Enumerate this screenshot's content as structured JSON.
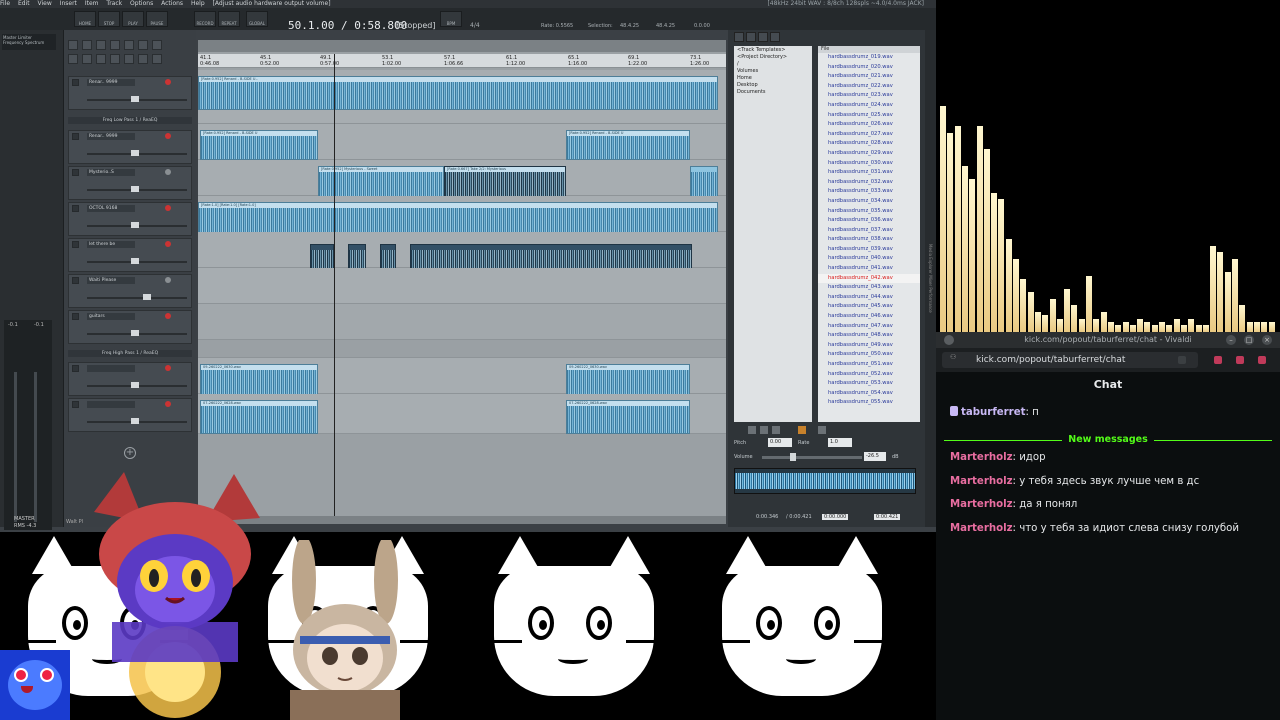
{
  "daw": {
    "menu": [
      "File",
      "Edit",
      "View",
      "Insert",
      "Item",
      "Track",
      "Options",
      "Actions",
      "Help",
      "[Adjust audio hardware output volume]"
    ],
    "status_right": "[48kHz 24bit WAV : 8/8ch 128spls ~4.0/4.0ms JACK]",
    "transport": {
      "time": "50.1.00 / 0:58.800",
      "state": "[Stopped]",
      "signature": "4/4",
      "rate": "Rate: 0.5565",
      "selection": "Selection:",
      "sel_start": "48.4.25",
      "sel_end": "48.4.25",
      "sel_len": "0.0.00",
      "buttons": [
        "HOME",
        "STOP",
        "PLAY",
        "PAUSE",
        "RECORD",
        "REPEAT",
        "GLOBAL AUTO",
        "BPM"
      ]
    },
    "master": {
      "label": "Master Limiter",
      "sub": "Frequency Spectrum",
      "rms": "RMS -4.3",
      "name": "MASTER",
      "db_left": "-0.1",
      "db_right": "-0.1"
    },
    "folders": [
      "Freq Low Pass 1 / ReaEQ",
      "Freq High Pass 1 / ReaEQ"
    ],
    "tracks": [
      {
        "name": "Renar.. 9999"
      },
      {
        "name": "Renar.. 9999"
      },
      {
        "name": "Mysterio..S"
      },
      {
        "name": "OCTOL 9168"
      },
      {
        "name": "let there be"
      },
      {
        "name": "Waiti Please"
      },
      {
        "name": "guitars"
      },
      {
        "name": ""
      },
      {
        "name": ""
      }
    ],
    "ruler_ticks": [
      "41.1",
      "45.1",
      "49.1",
      "53.1",
      "57.1",
      "61.1",
      "65.1",
      "69.1",
      "73.1"
    ],
    "ruler_times": [
      "0:46.08",
      "0:52.00",
      "0:57.00",
      "1:02.00",
      "1:06.66",
      "1:12.00",
      "1:16.00",
      "1:22.00",
      "1:26.00"
    ],
    "items": {
      "renard1": "[Rate:0.952] Renard - B-SIDE U..",
      "renard2": "[Rate:0.952] Renard - B-SIDE U",
      "myst": "[Rate:0.952] Mysterious - Sweet",
      "take": "[Rate:0.667] Take 2/2: Mysterious",
      "octo": "[Rate:1.0] [Rate:1.0] [Rate:1.0]",
      "clip1": "09-260222_0630.wav",
      "clip2": "07-260222_0628.wav"
    },
    "bottom_label": "Walt Pl"
  },
  "media_explorer": {
    "tree": [
      "<Track Templates>",
      "<Project Directory>",
      "/",
      "Volumes",
      "Home",
      "Desktop",
      "Documents"
    ],
    "list_header": "File",
    "files": [
      "hardbassdrumz_019.wav",
      "hardbassdrumz_020.wav",
      "hardbassdrumz_021.wav",
      "hardbassdrumz_022.wav",
      "hardbassdrumz_023.wav",
      "hardbassdrumz_024.wav",
      "hardbassdrumz_025.wav",
      "hardbassdrumz_026.wav",
      "hardbassdrumz_027.wav",
      "hardbassdrumz_028.wav",
      "hardbassdrumz_029.wav",
      "hardbassdrumz_030.wav",
      "hardbassdrumz_031.wav",
      "hardbassdrumz_032.wav",
      "hardbassdrumz_033.wav",
      "hardbassdrumz_034.wav",
      "hardbassdrumz_035.wav",
      "hardbassdrumz_036.wav",
      "hardbassdrumz_037.wav",
      "hardbassdrumz_038.wav",
      "hardbassdrumz_039.wav",
      "hardbassdrumz_040.wav",
      "hardbassdrumz_041.wav",
      "hardbassdrumz_042.wav",
      "hardbassdrumz_043.wav",
      "hardbassdrumz_044.wav",
      "hardbassdrumz_045.wav",
      "hardbassdrumz_046.wav",
      "hardbassdrumz_047.wav",
      "hardbassdrumz_048.wav",
      "hardbassdrumz_049.wav",
      "hardbassdrumz_050.wav",
      "hardbassdrumz_051.wav",
      "hardbassdrumz_052.wav",
      "hardbassdrumz_053.wav",
      "hardbassdrumz_054.wav",
      "hardbassdrumz_055.wav"
    ],
    "selected_index": 23,
    "pitch_label": "Pitch",
    "pitch_value": "0.00",
    "rate_label": "Rate",
    "rate_value": "1.0",
    "volume_label": "Volume",
    "volume_value": "-26.5",
    "volume_unit": "dB",
    "pos_a": "0:00.346",
    "pos_b": "/ 0:00.421",
    "pos_c": "0:00.000",
    "pos_d": "0:00.421",
    "side_tabs": "Media Explorer Mixer Performance"
  },
  "visualizer": {
    "levels": [
      0.68,
      0.6,
      0.62,
      0.5,
      0.46,
      0.62,
      0.55,
      0.42,
      0.4,
      0.28,
      0.22,
      0.16,
      0.12,
      0.06,
      0.05,
      0.1,
      0.04,
      0.13,
      0.08,
      0.04,
      0.17,
      0.04,
      0.06,
      0.03,
      0.02,
      0.03,
      0.02,
      0.04,
      0.03,
      0.02,
      0.03,
      0.02,
      0.04,
      0.02,
      0.04,
      0.02,
      0.02,
      0.26,
      0.24,
      0.18,
      0.22,
      0.08,
      0.03,
      0.03,
      0.03,
      0.03
    ]
  },
  "browser": {
    "title": "kick.com/popout/taburferret/chat - Vivaldi",
    "url": "kick.com/popout/taburferret/chat"
  },
  "chat": {
    "header": "Chat",
    "new_messages": "New messages",
    "messages": [
      {
        "user": "taburferret",
        "sep": ": ",
        "text": "п"
      },
      {
        "user": "Marterholz",
        "sep": ": ",
        "text": "идор"
      },
      {
        "user": "Marterholz",
        "sep": ": ",
        "text": "у тебя здесь звук лучше чем в дс"
      },
      {
        "user": "Marterholz",
        "sep": ": ",
        "text": "да я понял"
      },
      {
        "user": "Marterholz",
        "sep": ": ",
        "text": "что у тебя за идиот слева снизу голубой"
      }
    ]
  },
  "colors": {
    "kick_green": "#53fc18",
    "user_pink": "#e96ea1",
    "selected_file": "#d81b1b",
    "waveform": "#8ec5e0"
  }
}
